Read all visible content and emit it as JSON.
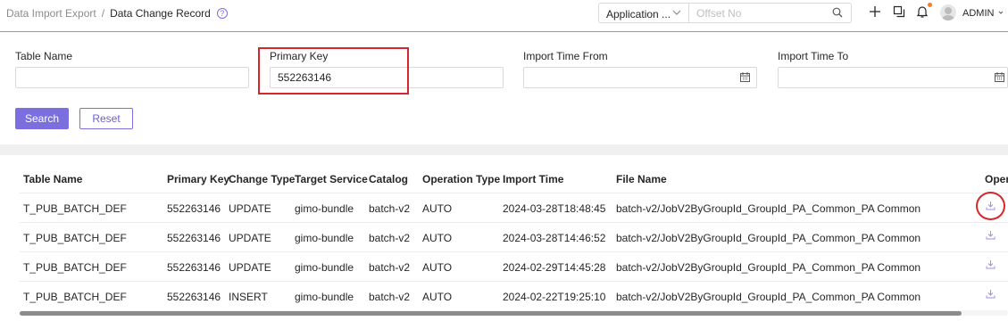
{
  "breadcrumb": {
    "parent": "Data Import Export",
    "separator": "/",
    "current": "Data Change Record"
  },
  "header": {
    "app_select_value": "Application ...",
    "offset_placeholder": "Offset No",
    "user_name": "ADMIN",
    "notification_dot_color": "#ff7a1a"
  },
  "filters": {
    "table_name": {
      "label": "Table Name",
      "value": ""
    },
    "primary_key": {
      "label": "Primary Key",
      "value": "552263146"
    },
    "import_time_from": {
      "label": "Import Time From",
      "value": ""
    },
    "import_time_to": {
      "label": "Import Time To",
      "value": ""
    }
  },
  "buttons": {
    "search": "Search",
    "reset": "Reset"
  },
  "table": {
    "columns": [
      "Table Name",
      "Primary Key",
      "Change Type",
      "Target Service",
      "Catalog",
      "Operation Type",
      "Import Time",
      "File Name",
      "Oper"
    ],
    "rows": [
      [
        "T_PUB_BATCH_DEF",
        "552263146",
        "UPDATE",
        "gimo-bundle",
        "batch-v2",
        "AUTO",
        "2024-03-28T18:48:45",
        "batch-v2/JobV2ByGroupId_GroupId_PA_Common_PA Common"
      ],
      [
        "T_PUB_BATCH_DEF",
        "552263146",
        "UPDATE",
        "gimo-bundle",
        "batch-v2",
        "AUTO",
        "2024-03-28T14:46:52",
        "batch-v2/JobV2ByGroupId_GroupId_PA_Common_PA Common"
      ],
      [
        "T_PUB_BATCH_DEF",
        "552263146",
        "UPDATE",
        "gimo-bundle",
        "batch-v2",
        "AUTO",
        "2024-02-29T14:45:28",
        "batch-v2/JobV2ByGroupId_GroupId_PA_Common_PA Common"
      ],
      [
        "T_PUB_BATCH_DEF",
        "552263146",
        "INSERT",
        "gimo-bundle",
        "batch-v2",
        "AUTO",
        "2024-02-22T19:25:10",
        "batch-v2/JobV2ByGroupId_GroupId_PA_Common_PA Common"
      ]
    ]
  },
  "colors": {
    "accent": "#7b6fe0",
    "annotation": "#d7262b"
  },
  "icons": [
    "help-icon",
    "chevron-down-icon",
    "search-icon",
    "plus-icon",
    "copy-icon",
    "bell-icon",
    "avatar",
    "calendar-icon",
    "download-icon"
  ]
}
